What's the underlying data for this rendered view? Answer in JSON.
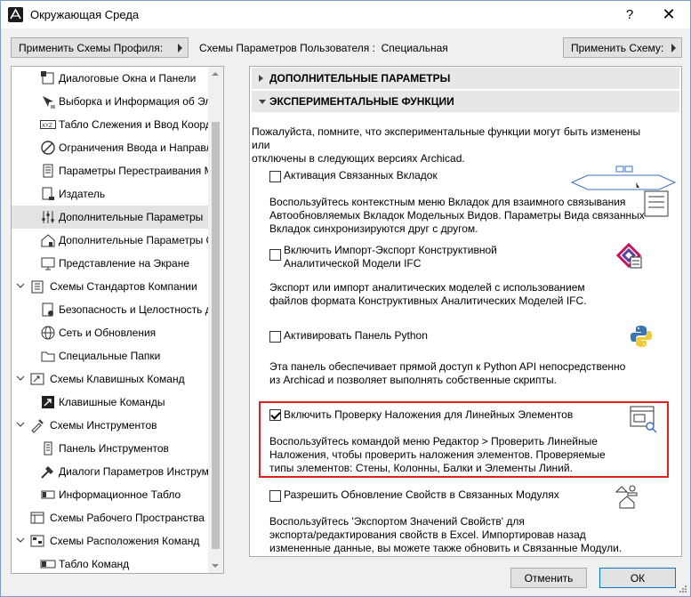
{
  "window": {
    "title": "Окружающая Среда",
    "help": "?",
    "close": "✕"
  },
  "toolbar": {
    "profile_button": "Применить Схемы Профиля:",
    "user_schemes_label": "Схемы Параметров Пользователя :",
    "user_schemes_value": "Специальная",
    "apply_button": "Применить Схему:"
  },
  "tree": {
    "items": [
      {
        "label": "Диалоговые Окна и Панели",
        "icon": "dialog-panels-icon"
      },
      {
        "label": "Выборка и Информация об Эле",
        "icon": "selection-info-icon"
      },
      {
        "label": "Табло Слежения и Ввод Коорди",
        "icon": "xyz-tracker-icon"
      },
      {
        "label": "Ограничения Ввода и Направл",
        "icon": "input-constraints-icon"
      },
      {
        "label": "Параметры Перестраивания Мо",
        "icon": "rebuild-options-icon"
      },
      {
        "label": "Издатель",
        "icon": "publisher-icon"
      },
      {
        "label": "Дополнительные Параметры",
        "icon": "more-options-icon"
      },
      {
        "label": "Дополнительные Параметры О",
        "icon": "house-options-icon"
      },
      {
        "label": "Представление на Экране",
        "icon": "on-screen-view-icon"
      },
      {
        "label": "Схемы Стандартов Компании",
        "icon": "company-standards-icon"
      },
      {
        "label": "Безопасность и Целостность да",
        "icon": "data-safety-icon"
      },
      {
        "label": "Сеть и Обновления",
        "icon": "network-icon"
      },
      {
        "label": "Специальные Папки",
        "icon": "special-folders-icon"
      },
      {
        "label": "Схемы Клавишных Команд",
        "icon": "keyboard-schemes-icon"
      },
      {
        "label": "Клавишные Команды",
        "icon": "keyboard-shortcuts-icon"
      },
      {
        "label": "Схемы Инструментов",
        "icon": "tool-schemes-icon"
      },
      {
        "label": "Панель Инструментов",
        "icon": "toolbox-icon"
      },
      {
        "label": "Диалоги Параметров Инструме",
        "icon": "tool-settings-icon"
      },
      {
        "label": "Информационное Табло",
        "icon": "info-box-icon"
      },
      {
        "label": "Схемы Рабочего Пространства",
        "icon": "workspace-schemes-icon"
      },
      {
        "label": "Схемы Расположения Команд",
        "icon": "command-layout-icon"
      },
      {
        "label": "Табло Команд",
        "icon": "command-bar-icon"
      }
    ]
  },
  "panel": {
    "section_advanced": "ДОПОЛНИТЕЛЬНЫЕ ПАРАМЕТРЫ",
    "section_experimental": "ЭКСПЕРИМЕНТАЛЬНЫЕ ФУНКЦИИ",
    "notice_line1": "Пожалуйста, помните, что экспериментальные функции могут быть изменены или",
    "notice_line2": "отключены в следующих версиях Archicad.",
    "opt1_label": "Активация Связанных Вкладок",
    "opt1_desc1": "Воспользуйтесь контекстным меню Вкладок для взаимного связывания",
    "opt1_desc2": "Автообновляемых Вкладок Модельных Видов. Параметры Вида связанных",
    "opt1_desc3": "Вкладок синхронизируются друг с другом.",
    "opt2_label1": "Включить Импорт-Экспорт Конструктивной",
    "opt2_label2": "Аналитической Модели IFC",
    "opt2_desc1": "Экспорт или импорт аналитических моделей с использованием",
    "opt2_desc2": "файлов формата Конструктивных Аналитических Моделей IFC.",
    "opt3_label": "Активировать Панель Python",
    "opt3_desc1": "Эта панель обеспечивает прямой доступ к Python API непосредственно",
    "opt3_desc2": "из Archicad и позволяет выполнять собственные скрипты.",
    "opt4_label": "Включить Проверку Наложения для Линейных Элементов",
    "opt4_desc1": "Воспользуйтесь командой меню Редактор > Проверить Линейные",
    "opt4_desc2": "Наложения, чтобы проверить наложения элементов. Проверяемые",
    "opt4_desc3": "типы элементов: Стены, Колонны, Балки и Элементы Линий.",
    "opt5_label": "Разрешить Обновление Свойств в Связанных Модулях",
    "opt5_desc1": "Воспользуйтесь 'Экспортом Значений Свойств' для",
    "opt5_desc2": "экспорта/редактирования свойств в Excel. Импортировав назад",
    "opt5_desc3": "измененные данные, вы можете также обновить и Связанные Модули."
  },
  "buttons": {
    "cancel": "Отменить",
    "ok": "ОК"
  }
}
